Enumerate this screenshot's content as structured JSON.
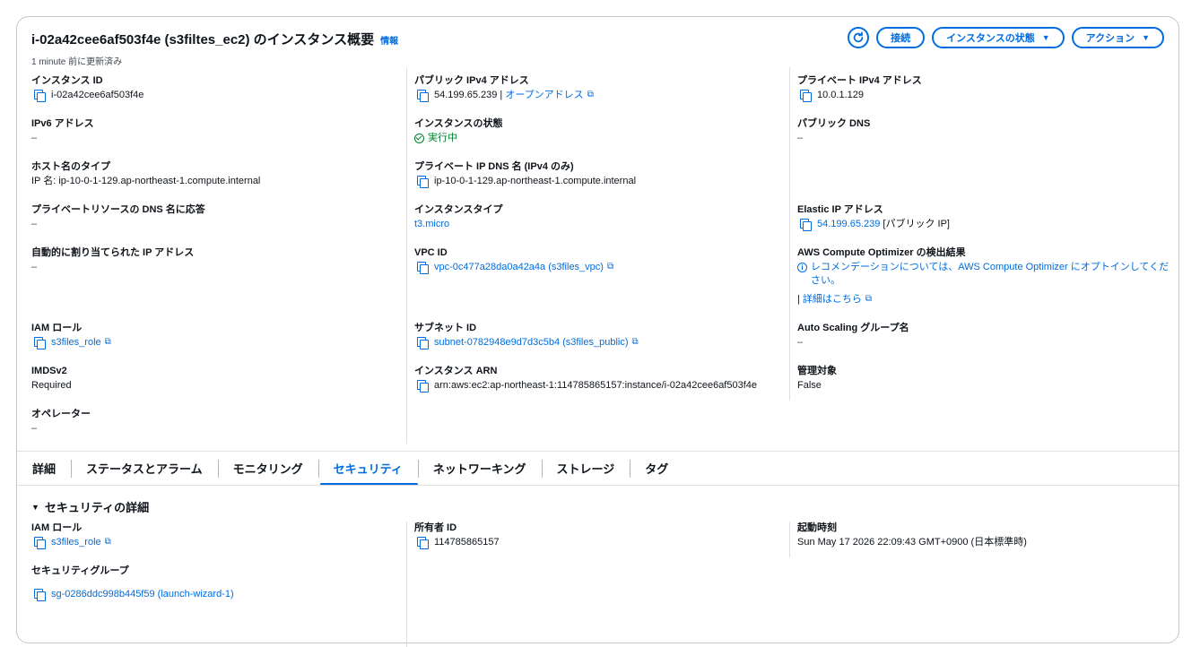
{
  "header": {
    "title": "i-02a42cee6af503f4e (s3filtes_ec2) のインスタンス概要",
    "info": "情報",
    "updated": "1 minute 前に更新済み",
    "buttons": {
      "refresh_icon": "refresh-icon",
      "connect": "接続",
      "instance_state": "インスタンスの状態",
      "actions": "アクション"
    }
  },
  "summary": {
    "col1": {
      "instance_id": {
        "label": "インスタンス ID",
        "value": "i-02a42cee6af503f4e"
      },
      "ipv6": {
        "label": "IPv6 アドレス",
        "value": "–"
      },
      "hostname_type": {
        "label": "ホスト名のタイプ",
        "value": "IP 名: ip-10-0-1-129.ap-northeast-1.compute.internal"
      },
      "private_dns_answer": {
        "label": "プライベートリソースの DNS 名に応答",
        "value": "–"
      },
      "auto_ip": {
        "label": "自動的に割り当てられた IP アドレス",
        "value": "–"
      },
      "iam_role": {
        "label": "IAM ロール",
        "value": "s3files_role"
      },
      "imdsv2": {
        "label": "IMDSv2",
        "value": "Required"
      },
      "operator": {
        "label": "オペレーター",
        "value": "–"
      }
    },
    "col2": {
      "public_ipv4": {
        "label": "パブリック IPv4 アドレス",
        "value": "54.199.65.239",
        "separator": "|",
        "link": "オープンアドレス"
      },
      "instance_state": {
        "label": "インスタンスの状態",
        "value": "実行中"
      },
      "private_ip_dns": {
        "label": "プライベート IP DNS 名 (IPv4 のみ)",
        "value": "ip-10-0-1-129.ap-northeast-1.compute.internal"
      },
      "instance_type": {
        "label": "インスタンスタイプ",
        "value": "t3.micro"
      },
      "vpc_id": {
        "label": "VPC ID",
        "value": "vpc-0c477a28da0a42a4a (s3files_vpc)"
      },
      "subnet_id": {
        "label": "サブネット ID",
        "value": "subnet-0782948e9d7d3c5b4 (s3files_public)"
      },
      "instance_arn": {
        "label": "インスタンス ARN",
        "value": "arn:aws:ec2:ap-northeast-1:114785865157:instance/i-02a42cee6af503f4e"
      }
    },
    "col3": {
      "private_ipv4": {
        "label": "プライベート IPv4 アドレス",
        "value": "10.0.1.129"
      },
      "public_dns": {
        "label": "パブリック DNS",
        "value": "–"
      },
      "elastic_ip": {
        "label": "Elastic IP アドレス",
        "value": "54.199.65.239",
        "suffix": "[パブリック IP]"
      },
      "optimizer": {
        "label": "AWS Compute Optimizer の検出結果",
        "value": "レコメンデーションについては、AWS Compute Optimizer にオプトインしてください。",
        "separator": "|",
        "link": "詳細はこちら"
      },
      "asg_name": {
        "label": "Auto Scaling グループ名",
        "value": "–"
      },
      "managed": {
        "label": "管理対象",
        "value": "False"
      }
    }
  },
  "tabs": [
    "詳細",
    "ステータスとアラーム",
    "モニタリング",
    "セキュリティ",
    "ネットワーキング",
    "ストレージ",
    "タグ"
  ],
  "active_tab": "セキュリティ",
  "security": {
    "heading": "セキュリティの詳細",
    "iam_role": {
      "label": "IAM ロール",
      "value": "s3files_role"
    },
    "security_group": {
      "label": "セキュリティグループ",
      "value": "sg-0286ddc998b445f59 (launch-wizard-1)"
    },
    "owner_id": {
      "label": "所有者 ID",
      "value": "114785865157"
    },
    "launch_time": {
      "label": "起動時刻",
      "value": "Sun May 17 2026 22:09:43 GMT+0900 (日本標準時)"
    }
  },
  "colors": {
    "link": "#006ce0",
    "success": "#00802f",
    "border": "#c6c6cd"
  }
}
